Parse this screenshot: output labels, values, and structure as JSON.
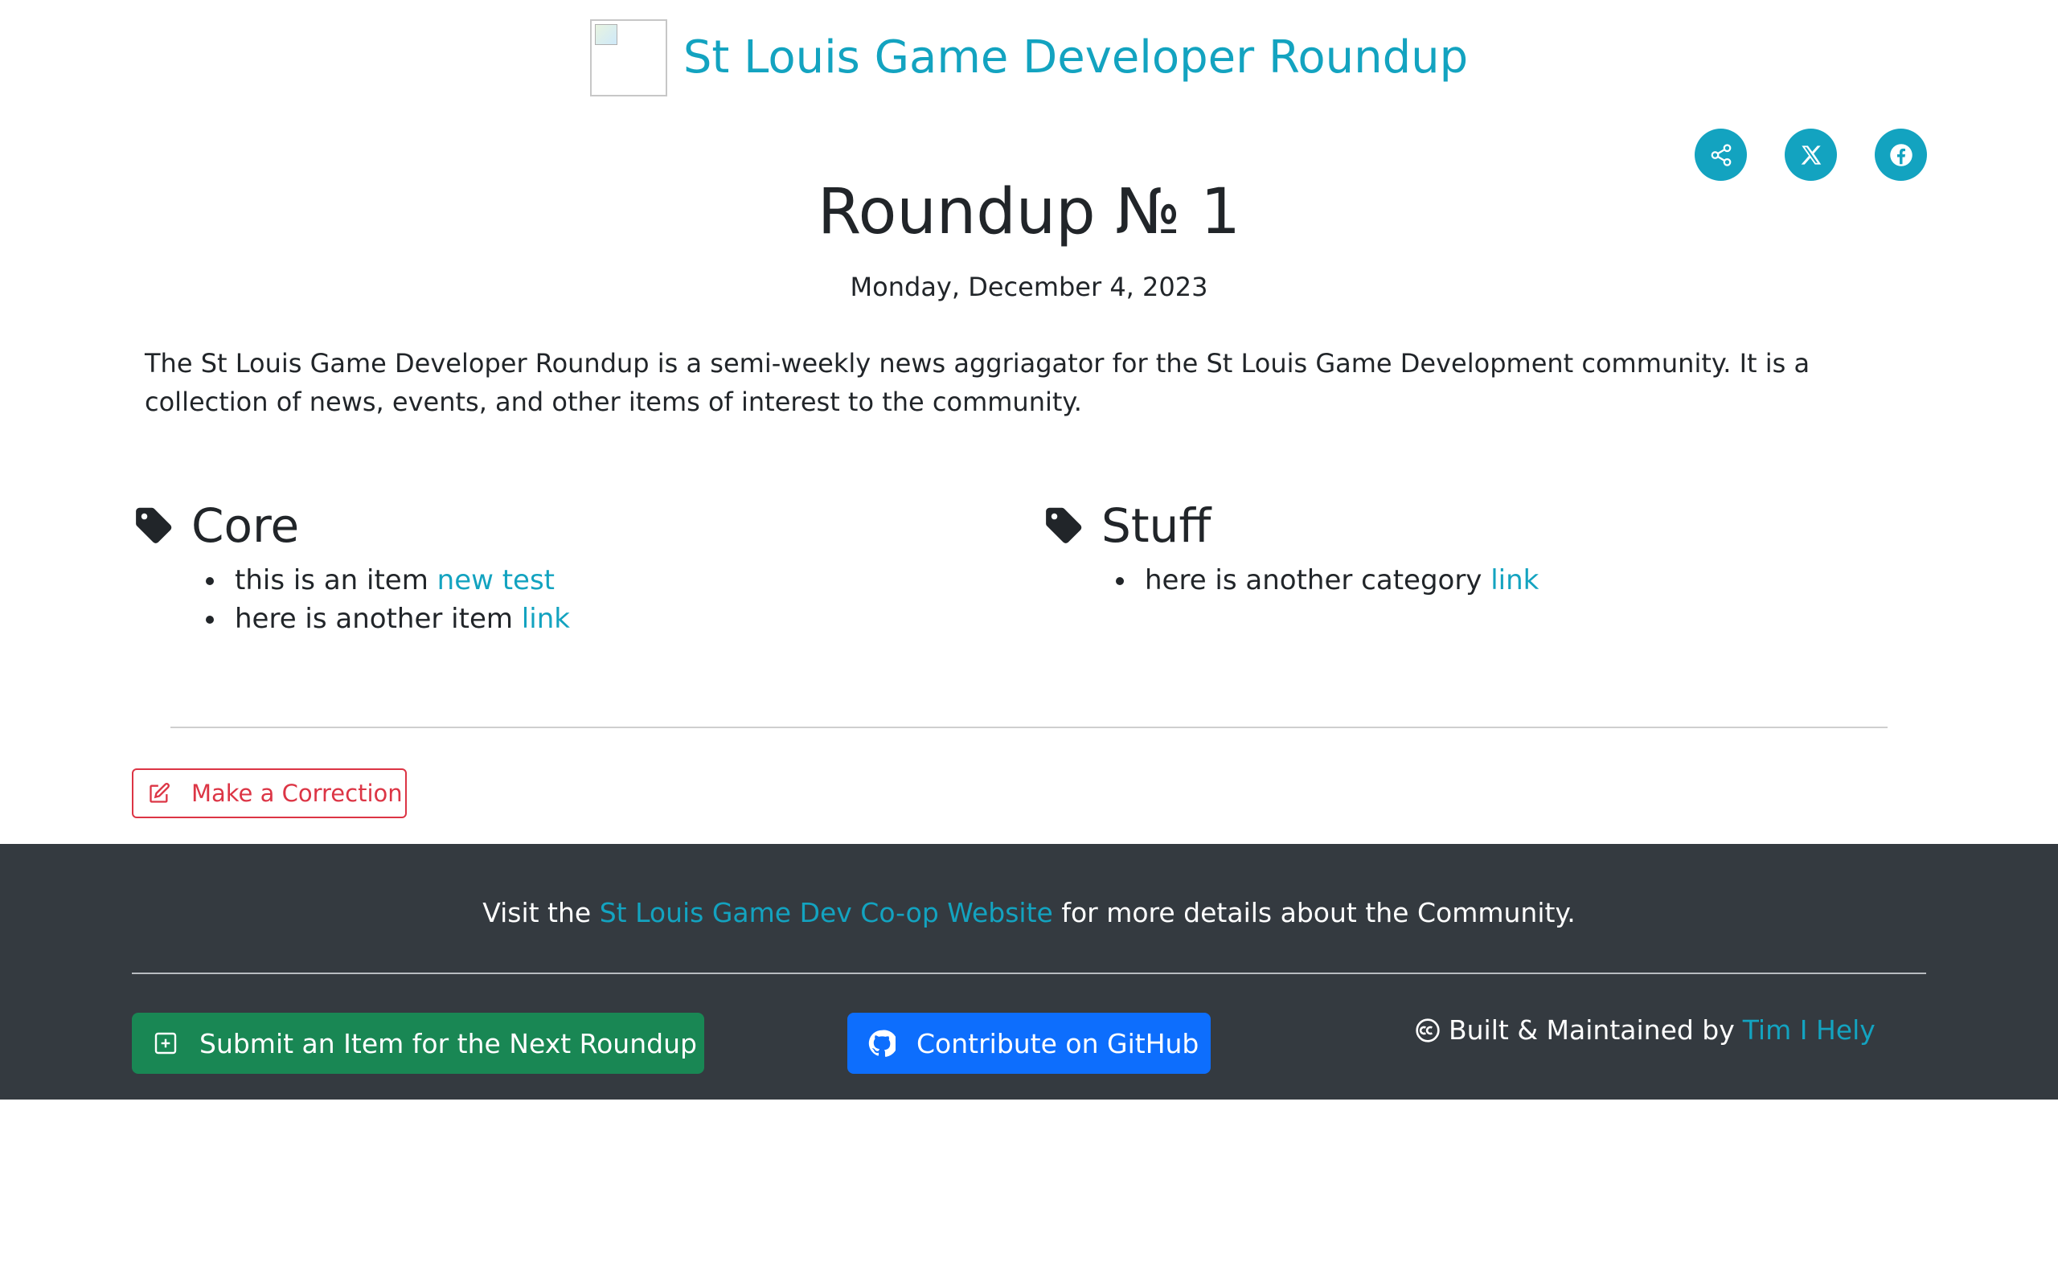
{
  "header": {
    "site_title": "St Louis Game Developer Roundup",
    "logo_icon": "broken-image-icon"
  },
  "share": {
    "items": [
      {
        "icon": "share-icon"
      },
      {
        "icon": "x-icon"
      },
      {
        "icon": "facebook-icon"
      }
    ],
    "color": "#13a3c0"
  },
  "main": {
    "title": "Roundup № 1",
    "date": "Monday, December 4, 2023",
    "intro": "The St Louis Game Developer Roundup is a semi-weekly news aggriagator for the St Louis Game Development community. It is a collection of news, events, and other items of interest to the community.",
    "categories": [
      {
        "title": "Core",
        "icon": "tag-icon",
        "items": [
          {
            "text": "this is an item ",
            "link": "new test"
          },
          {
            "text": "here is another item ",
            "link": "link"
          }
        ]
      },
      {
        "title": "Stuff",
        "icon": "tag-icon",
        "items": [
          {
            "text": "here is another category ",
            "link": "link"
          }
        ]
      }
    ],
    "correction_label": "Make a Correction"
  },
  "footer": {
    "visit_prefix": "Visit the ",
    "visit_link": "St Louis Game Dev Co-op Website",
    "visit_suffix": " for more details about the Community.",
    "submit_label": "Submit an Item for the Next Roundup",
    "github_label": "Contribute on GitHub",
    "built_prefix": "Built & Maintained by ",
    "built_link": "Tim I Hely"
  },
  "colors": {
    "accent": "#13a3c0",
    "danger": "#dc3545",
    "success": "#198754",
    "primary": "#0d6efd",
    "footer_bg": "#343a40"
  }
}
